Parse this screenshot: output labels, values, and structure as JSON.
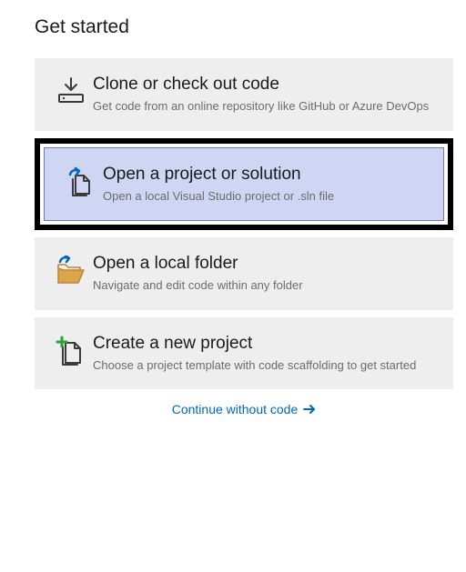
{
  "heading": "Get started",
  "cards": {
    "clone": {
      "title": "Clone or check out code",
      "desc": "Get code from an online repository like GitHub or Azure DevOps"
    },
    "open_project": {
      "title": "Open a project or solution",
      "desc": "Open a local Visual Studio project or .sln file"
    },
    "open_folder": {
      "title": "Open a local folder",
      "desc": "Navigate and edit code within any folder"
    },
    "new_project": {
      "title": "Create a new project",
      "desc": "Choose a project template with code scaffolding to get started"
    }
  },
  "continue_link": "Continue without code"
}
